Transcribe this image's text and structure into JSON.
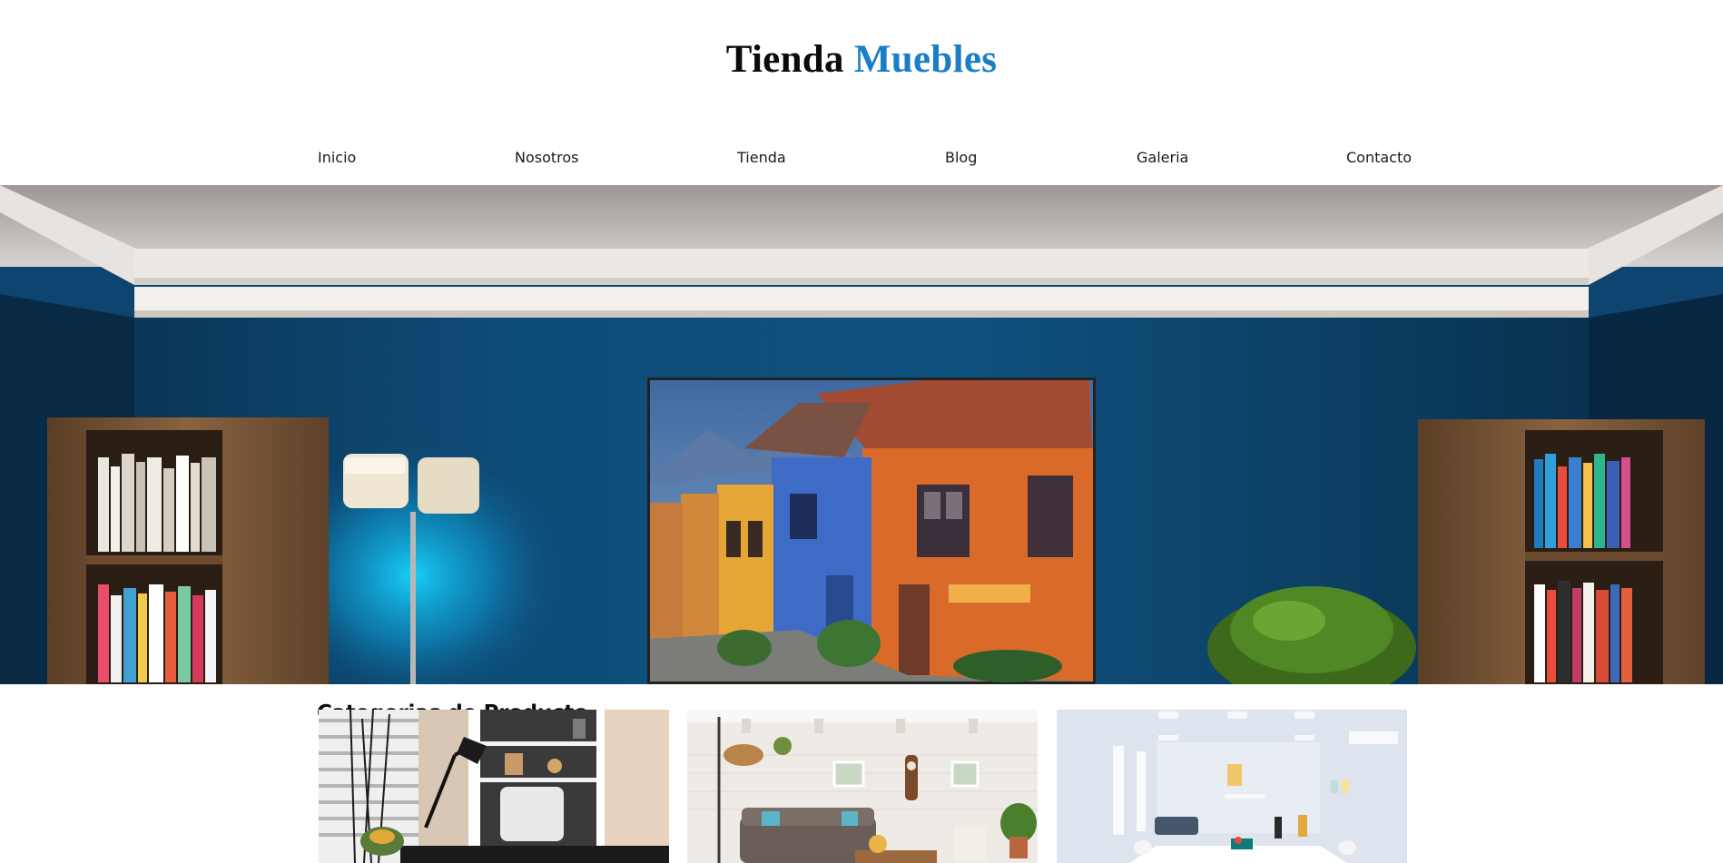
{
  "site": {
    "logo_part1": "Tienda",
    "logo_part2": "Muebles",
    "accent_color": "#1a7ec6"
  },
  "nav": {
    "items": [
      {
        "label": "Inicio"
      },
      {
        "label": "Nosotros"
      },
      {
        "label": "Tienda"
      },
      {
        "label": "Blog"
      },
      {
        "label": "Galeria"
      },
      {
        "label": "Contacto"
      }
    ]
  },
  "hero": {
    "image": "living-room-blue-wall-painting"
  },
  "categories": {
    "title": "Categorias de Producto",
    "cards": [
      {
        "image": "home-office"
      },
      {
        "image": "living-room"
      },
      {
        "image": "dining-room"
      }
    ]
  }
}
